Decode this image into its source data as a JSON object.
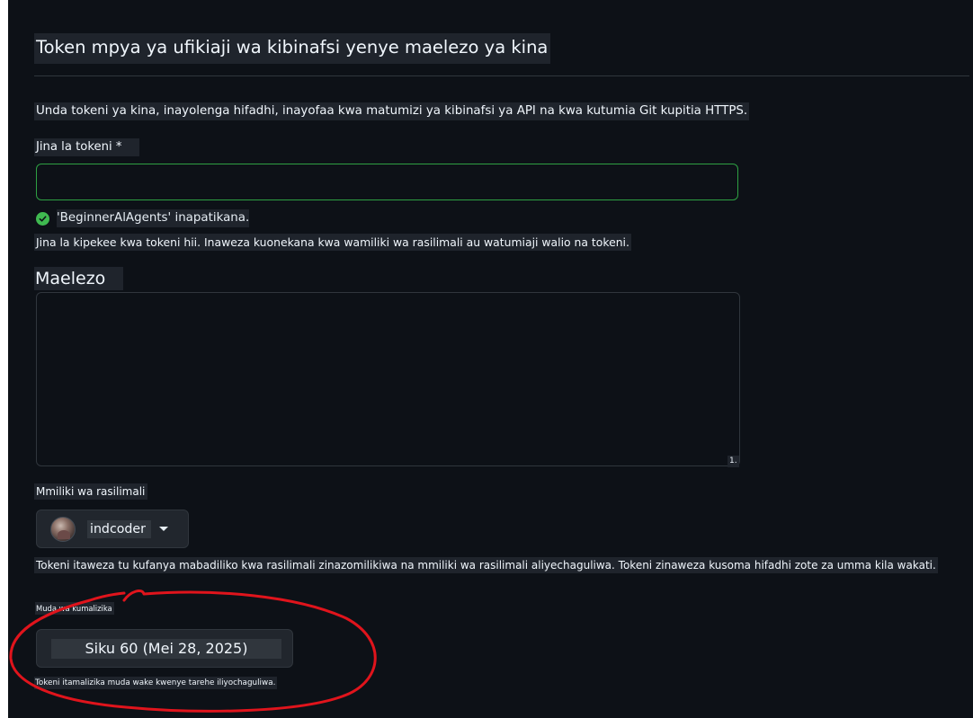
{
  "page": {
    "title": "Token mpya ya ufikiaji wa kibinafsi yenye maelezo ya kina",
    "subtitle": "Unda tokeni ya kina, inayolenga hifadhi, inayofaa kwa matumizi ya kibinafsi ya API na kwa kutumia Git kupitia HTTPS."
  },
  "token_name": {
    "label": "Jina la tokeni *",
    "value": "",
    "validation": "'BeginnerAlAgents' inapatikana.",
    "help": "Jina la kipekee kwa tokeni hii. Inaweza kuonekana kwa wamiliki wa rasilimali au watumiaji walio na tokeni."
  },
  "description": {
    "label": "Maelezo",
    "value": "",
    "counter": "1."
  },
  "owner": {
    "label": "Mmiliki wa rasilimali",
    "selected": "indcoder",
    "help": "Tokeni itaweza tu kufanya mabadiliko kwa rasilimali zinazomilikiwa na mmiliki wa rasilimali aliyechaguliwa. Tokeni zinaweza kusoma hifadhi zote za umma kila wakati."
  },
  "expiration": {
    "label": "Muda wa kumalizika",
    "selected": "Siku 60 (Mei 28, 2025)",
    "help": "Tokeni itamalizika muda wake kwenye tarehe iliyochaguliwa."
  },
  "colors": {
    "background": "#0d1117",
    "valid_border": "#2ea043",
    "success": "#3fb950",
    "annotation": "#e0141c"
  },
  "icons": {
    "validation": "check-circle-icon",
    "owner_dropdown": "triangle-down-icon"
  }
}
